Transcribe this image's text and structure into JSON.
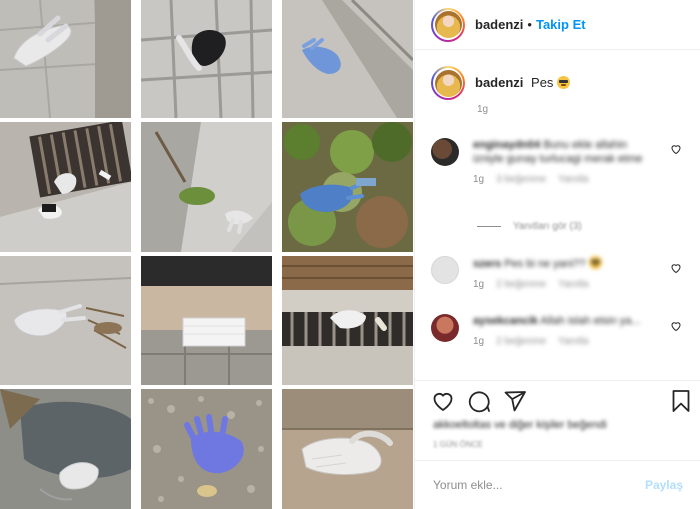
{
  "post": {
    "username": "badenzi",
    "separator": "•",
    "follow_label": "Takip Et",
    "caption_username": "badenzi",
    "caption_text": "Pes",
    "caption_time": "1g"
  },
  "comments": [
    {
      "user": "enginaydn04",
      "text": "Bunu ekle allahin izniyle gunay turlucagi merak etme",
      "time": "1g",
      "likes": "3 beğenme",
      "reply": "Yanıtla"
    },
    {
      "user": "szers",
      "text": "Pes bi ne yani??",
      "time": "1g",
      "likes": "2 beğenme",
      "reply": "Yanıtla"
    },
    {
      "user": "aysekcancik",
      "text": "Allah islah etsin ya...",
      "time": "1g",
      "likes": "2 beğenme",
      "reply": "Yanıtla"
    }
  ],
  "replies_label": "Yanıtları gör (3)",
  "likes_text": "akkoeltoltas ve diğer kişiler beğendi",
  "date_text": "1 GÜN ÖNCE",
  "add_comment": {
    "placeholder": "Yorum ekle...",
    "post_label": "Paylaş"
  },
  "icons": {
    "like": "heart-icon",
    "comment": "comment-icon",
    "share": "share-icon",
    "save": "bookmark-icon"
  },
  "colors": {
    "follow": "#0095f6",
    "post_disabled": "#b2dffc",
    "muted": "#8e8e8e"
  }
}
